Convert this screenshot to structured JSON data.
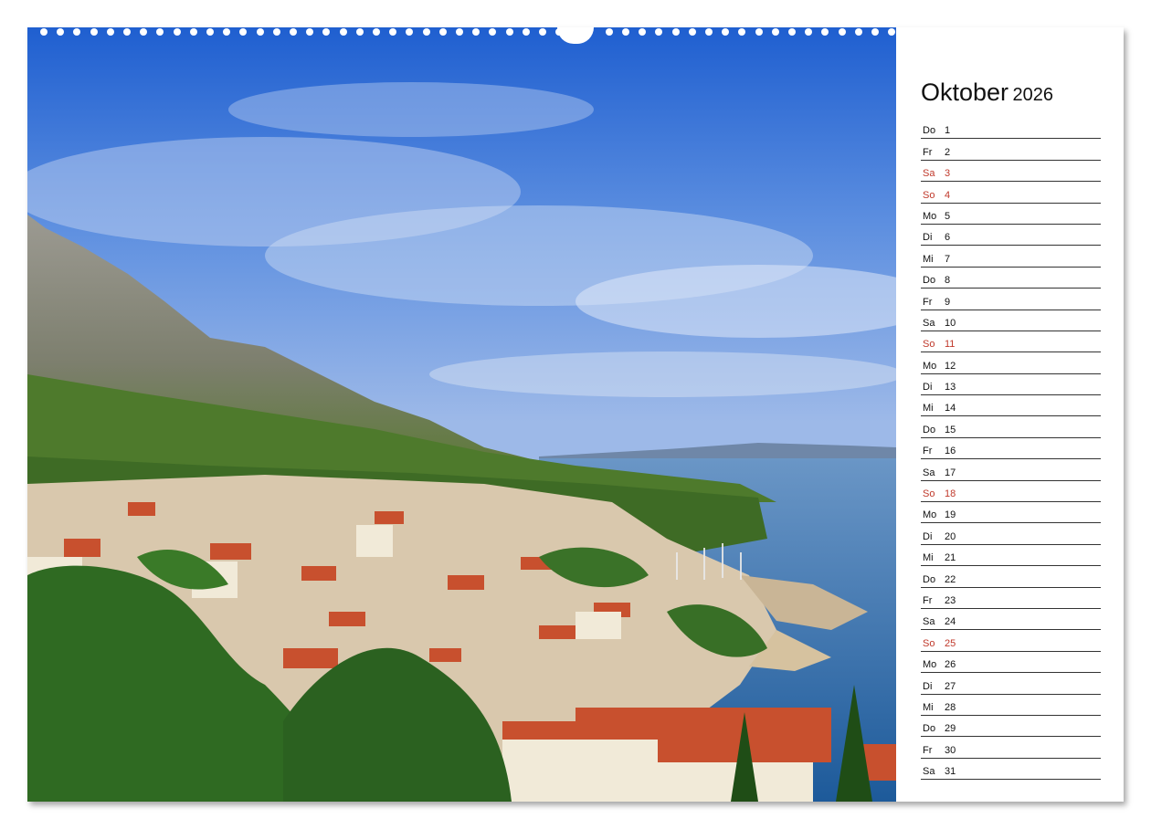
{
  "calendar": {
    "month": "Oktober",
    "year": "2026",
    "days": [
      {
        "weekday": "Do",
        "day": "1",
        "holiday": false
      },
      {
        "weekday": "Fr",
        "day": "2",
        "holiday": false
      },
      {
        "weekday": "Sa",
        "day": "3",
        "holiday": true
      },
      {
        "weekday": "So",
        "day": "4",
        "holiday": true
      },
      {
        "weekday": "Mo",
        "day": "5",
        "holiday": false
      },
      {
        "weekday": "Di",
        "day": "6",
        "holiday": false
      },
      {
        "weekday": "Mi",
        "day": "7",
        "holiday": false
      },
      {
        "weekday": "Do",
        "day": "8",
        "holiday": false
      },
      {
        "weekday": "Fr",
        "day": "9",
        "holiday": false
      },
      {
        "weekday": "Sa",
        "day": "10",
        "holiday": false
      },
      {
        "weekday": "So",
        "day": "11",
        "holiday": true
      },
      {
        "weekday": "Mo",
        "day": "12",
        "holiday": false
      },
      {
        "weekday": "Di",
        "day": "13",
        "holiday": false
      },
      {
        "weekday": "Mi",
        "day": "14",
        "holiday": false
      },
      {
        "weekday": "Do",
        "day": "15",
        "holiday": false
      },
      {
        "weekday": "Fr",
        "day": "16",
        "holiday": false
      },
      {
        "weekday": "Sa",
        "day": "17",
        "holiday": false
      },
      {
        "weekday": "So",
        "day": "18",
        "holiday": true
      },
      {
        "weekday": "Mo",
        "day": "19",
        "holiday": false
      },
      {
        "weekday": "Di",
        "day": "20",
        "holiday": false
      },
      {
        "weekday": "Mi",
        "day": "21",
        "holiday": false
      },
      {
        "weekday": "Do",
        "day": "22",
        "holiday": false
      },
      {
        "weekday": "Fr",
        "day": "23",
        "holiday": false
      },
      {
        "weekday": "Sa",
        "day": "24",
        "holiday": false
      },
      {
        "weekday": "So",
        "day": "25",
        "holiday": true
      },
      {
        "weekday": "Mo",
        "day": "26",
        "holiday": false
      },
      {
        "weekday": "Di",
        "day": "27",
        "holiday": false
      },
      {
        "weekday": "Mi",
        "day": "28",
        "holiday": false
      },
      {
        "weekday": "Do",
        "day": "29",
        "holiday": false
      },
      {
        "weekday": "Fr",
        "day": "30",
        "holiday": false
      },
      {
        "weekday": "Sa",
        "day": "31",
        "holiday": false
      }
    ]
  },
  "colors": {
    "holiday_text": "#c0392b",
    "sky": "#2f6fd6",
    "sea": "#2a6aa8",
    "foliage": "#2f6a22",
    "roofs": "#c8502e"
  }
}
